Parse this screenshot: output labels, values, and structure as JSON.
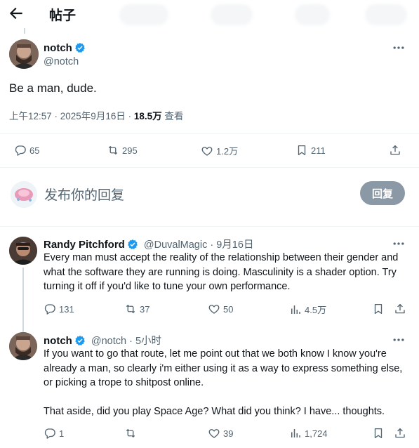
{
  "header": {
    "title": "帖子"
  },
  "main_post": {
    "author_name": "notch",
    "handle": "@notch",
    "text": "Be a man, dude.",
    "time": "上午12:57 · 2025年9月16日 · ",
    "views_count": "18.5万",
    "views_label": " 查看",
    "stats": {
      "replies": "65",
      "reposts": "295",
      "likes": "1.2万",
      "bookmarks": "211"
    }
  },
  "compose": {
    "placeholder": "发布你的回复",
    "button": "回复"
  },
  "replies": [
    {
      "author_name": "Randy Pitchford",
      "handle": "@DuvalMagic",
      "time": "· 9月16日",
      "text": "Every man must accept the reality of the relationship between their gender and what the software they are running is doing. Masculinity is a shader option. Try turning it off if you'd like to tune your own performance.",
      "stats": {
        "replies": "131",
        "reposts": "37",
        "likes": "50",
        "views": "4.5万"
      }
    },
    {
      "author_name": "notch",
      "handle": "@notch",
      "time": "· 5小时",
      "text": "If you want to go that route, let me point out that we both know I know you're already a man, so clearly i'm either using it as a way to express something else, or picking a trope to shitpost online.",
      "text2": "That aside, did you play Space Age? What did you think? I have... thoughts.",
      "stats": {
        "replies": "1",
        "reposts": "",
        "likes": "39",
        "views": "1,724"
      }
    }
  ],
  "colors": {
    "accent": "#1d9bf0",
    "muted": "#536471",
    "button_disabled": "#8b98a5"
  }
}
